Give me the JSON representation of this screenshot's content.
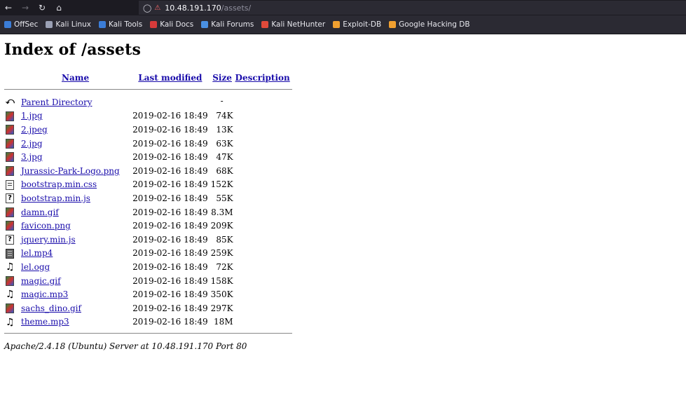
{
  "browser": {
    "url_host": "10.48.191.170",
    "url_path": "/assets/",
    "bookmarks": [
      {
        "label": "OffSec",
        "color": "#3b7dd8"
      },
      {
        "label": "Kali Linux",
        "color": "#2b2a33"
      },
      {
        "label": "Kali Tools",
        "color": "#3b7dd8"
      },
      {
        "label": "Kali Docs",
        "color": "#d63a3a"
      },
      {
        "label": "Kali Forums",
        "color": "#4a90e2"
      },
      {
        "label": "Kali NetHunter",
        "color": "#e04a3a"
      },
      {
        "label": "Exploit-DB",
        "color": "#f0a030"
      },
      {
        "label": "Google Hacking DB",
        "color": "#f0a030"
      }
    ]
  },
  "page": {
    "title": "Index of /assets",
    "columns": {
      "name": "Name",
      "modified": "Last modified",
      "size": "Size",
      "description": "Description"
    },
    "parent": {
      "label": "Parent Directory",
      "size": "-"
    },
    "files": [
      {
        "name": "1.jpg",
        "modified": "2019-02-16 18:49",
        "size": "74K",
        "icon": "image"
      },
      {
        "name": "2.jpeg",
        "modified": "2019-02-16 18:49",
        "size": "13K",
        "icon": "image"
      },
      {
        "name": "2.jpg",
        "modified": "2019-02-16 18:49",
        "size": "63K",
        "icon": "image"
      },
      {
        "name": "3.jpg",
        "modified": "2019-02-16 18:49",
        "size": "47K",
        "icon": "image"
      },
      {
        "name": "Jurassic-Park-Logo.png",
        "modified": "2019-02-16 18:49",
        "size": "68K",
        "icon": "image"
      },
      {
        "name": "bootstrap.min.css",
        "modified": "2019-02-16 18:49",
        "size": "152K",
        "icon": "text"
      },
      {
        "name": "bootstrap.min.js",
        "modified": "2019-02-16 18:49",
        "size": "55K",
        "icon": "unknown"
      },
      {
        "name": "damn.gif",
        "modified": "2019-02-16 18:49",
        "size": "8.3M",
        "icon": "image"
      },
      {
        "name": "favicon.png",
        "modified": "2019-02-16 18:49",
        "size": "209K",
        "icon": "image"
      },
      {
        "name": "jquery.min.js",
        "modified": "2019-02-16 18:49",
        "size": "85K",
        "icon": "unknown"
      },
      {
        "name": "lel.mp4",
        "modified": "2019-02-16 18:49",
        "size": "259K",
        "icon": "video"
      },
      {
        "name": "lel.ogg",
        "modified": "2019-02-16 18:49",
        "size": "72K",
        "icon": "sound"
      },
      {
        "name": "magic.gif",
        "modified": "2019-02-16 18:49",
        "size": "158K",
        "icon": "image"
      },
      {
        "name": "magic.mp3",
        "modified": "2019-02-16 18:49",
        "size": "350K",
        "icon": "sound"
      },
      {
        "name": "sachs_dino.gif",
        "modified": "2019-02-16 18:49",
        "size": "297K",
        "icon": "image"
      },
      {
        "name": "theme.mp3",
        "modified": "2019-02-16 18:49",
        "size": "18M",
        "icon": "sound"
      }
    ],
    "footer": "Apache/2.4.18 (Ubuntu) Server at 10.48.191.170 Port 80"
  }
}
